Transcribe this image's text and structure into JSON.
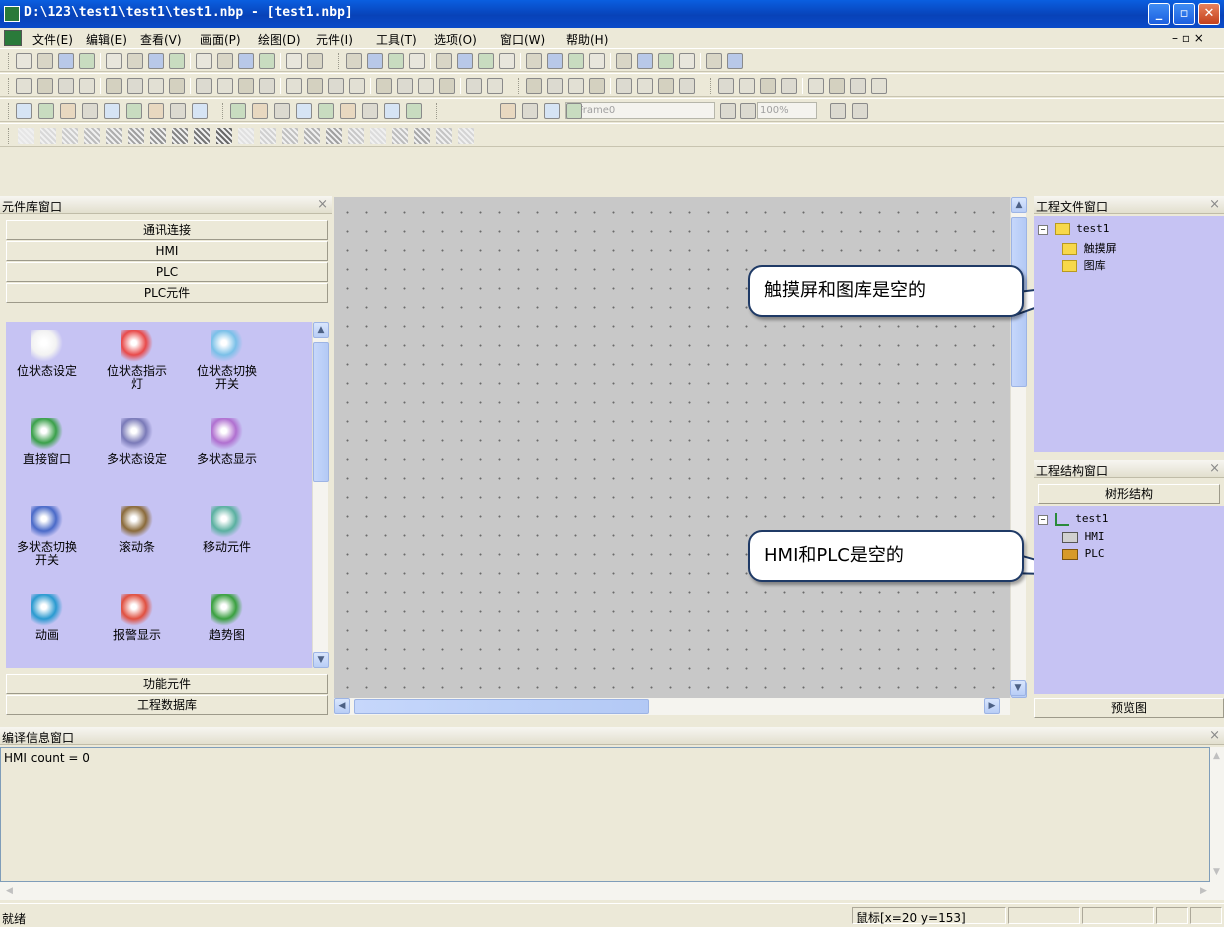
{
  "window": {
    "title": "D:\\123\\test1\\test1\\test1.nbp - [test1.nbp]"
  },
  "menu": [
    "文件(E)",
    "编辑(E)",
    "查看(V)",
    "画面(P)",
    "绘图(D)",
    "元件(I)",
    "工具(T)",
    "选项(O)",
    "窗口(W)",
    "帮助(H)"
  ],
  "mdi_controls": "– ▫ ×",
  "toolbar_frame_combo": "0:Frame0",
  "toolbar_zoom_combo": "100%",
  "component_panel": {
    "title": "元件库窗口",
    "categories_top": [
      "通讯连接",
      "HMI",
      "PLC",
      "PLC元件"
    ],
    "components": [
      {
        "label": "位状态设定",
        "icon": "lightbulb-on-icon"
      },
      {
        "label": "位状态指示灯",
        "icon": "indicator-lamp-icon"
      },
      {
        "label": "位状态切换开关",
        "icon": "toggle-switch-icon"
      },
      {
        "label": "直接窗口",
        "icon": "direct-window-icon"
      },
      {
        "label": "多状态设定",
        "icon": "multi-state-set-icon"
      },
      {
        "label": "多状态显示",
        "icon": "multi-state-display-icon"
      },
      {
        "label": "多状态切换开关",
        "icon": "multi-state-switch-icon"
      },
      {
        "label": "滚动条",
        "icon": "scrollbar-icon"
      },
      {
        "label": "移动元件",
        "icon": "move-component-icon"
      },
      {
        "label": "动画",
        "icon": "animation-icon"
      },
      {
        "label": "报警显示",
        "icon": "alarm-display-icon"
      },
      {
        "label": "趋势图",
        "icon": "trend-chart-icon"
      }
    ],
    "categories_bottom": [
      "功能元件",
      "工程数据库"
    ]
  },
  "project_file_panel": {
    "title": "工程文件窗口",
    "root": "test1",
    "children": [
      "触摸屏",
      "图库"
    ]
  },
  "project_structure_panel": {
    "title": "工程结构窗口",
    "tab": "树形结构",
    "root": "test1",
    "children": [
      "HMI",
      "PLC"
    ],
    "preview_button": "预览图"
  },
  "callouts": {
    "file_note": "触摸屏和图库是空的",
    "structure_note": "HMI和PLC是空的"
  },
  "compile_panel": {
    "title": "编译信息窗口",
    "output": "HMI count = 0"
  },
  "statusbar": {
    "status": "就绪",
    "mouse": "鼠标[x=20  y=153]"
  }
}
